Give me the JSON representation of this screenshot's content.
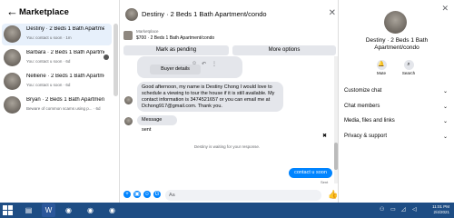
{
  "left": {
    "back_icon": "arrow-left-icon",
    "title": "Marketplace",
    "conversations": [
      {
        "name": "Destiny · 2 Beds 1 Bath Apartme...",
        "sub": "You: contact u soon · 1m"
      },
      {
        "name": "Barbara · 2 Beds 1 Bath Apartme...",
        "sub": "You: contact u soon · 6d"
      },
      {
        "name": "Nelliene · 2 Beds 1 Bath Apartme...",
        "sub": "You: contact u soon · 6d"
      },
      {
        "name": "Bryan · 2 Beds 1 Bath Apartmen...",
        "sub": "Beware of common scams using p... · 6d"
      }
    ]
  },
  "middle": {
    "header_title": "Destiny · 2 Beds 1 Bath Apartment/condo",
    "listing_label": "Marketplace",
    "listing_price": "$700 · 2 Beds 1 Bath Apartment/condo",
    "mark_pending": "Mark as pending",
    "more_options": "More options",
    "buyer_details": "Buyer details",
    "message_text": "Good afternoon, my name is Destiny Chong I would love to schedule a viewing to tour the house if it is still available. My contact information is 3474521657 or you can email me at Dchong917@gmail.com. Thank you.",
    "message_sent": "Message sent",
    "waiting_text": "Destiny is waiting for your response.",
    "my_message": "contact u soon",
    "sent_label": "Sent",
    "composer_placeholder": "Aa"
  },
  "right": {
    "name": "Destiny · 2 Beds 1 Bath Apartment/condo",
    "mute_label": "Mute",
    "search_label": "Search",
    "rows": [
      "Customize chat",
      "Chat members",
      "Media, files and links",
      "Privacy & support"
    ]
  },
  "taskbar": {
    "time": "11:01 PM",
    "date": "2/4/2021"
  },
  "colors": {
    "accent": "#0084ff",
    "taskbar": "#1e4d84",
    "bubble": "#e4e6eb",
    "active_row": "#e7f0fb"
  }
}
